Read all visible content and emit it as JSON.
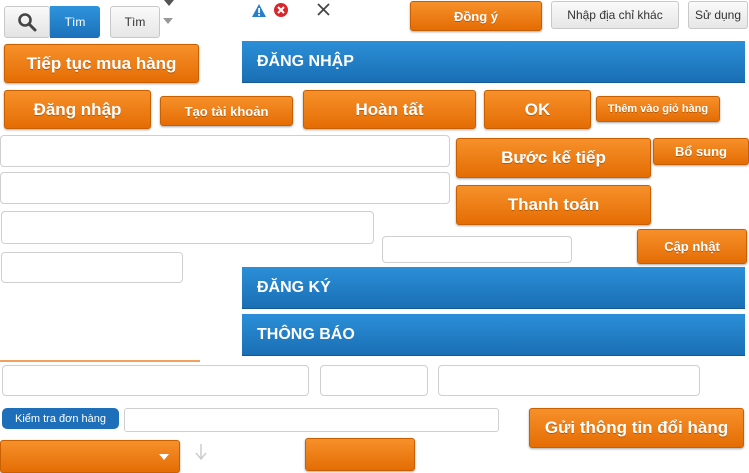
{
  "top_bar": {
    "search_button_label": "Tìm",
    "search_button2_label": "Tìm",
    "agree_label": "Đồng ý",
    "other_address_label": "Nhập địa chỉ khác",
    "use_label": "Sử dụng"
  },
  "buttons": {
    "continue_shopping": "Tiếp tục mua hàng",
    "login": "Đăng nhập",
    "create_account": "Tạo tài khoản",
    "complete": "Hoàn tất",
    "ok": "OK",
    "add_to_cart": "Thêm vào giỏ hàng",
    "next_step": "Bước kế tiếp",
    "supplement": "Bổ sung",
    "checkout": "Thanh toán",
    "update": "Cập nhật",
    "send_exchange_info": "Gửi thông tin đổi hàng",
    "check_order": "Kiểm tra đơn hàng"
  },
  "sections": {
    "login_header": "ĐĂNG NHẬP",
    "register_header": "ĐĂNG KÝ",
    "notice_header": "THÔNG BÁO"
  },
  "icons": {
    "search": "magnifier-icon",
    "warning": "warning-icon",
    "error": "error-icon",
    "close": "close-icon",
    "dropdown": "chevron-down-icon"
  },
  "colors": {
    "accent_orange": "#f08018",
    "header_blue": "#1f7cc4",
    "pill_blue": "#1c6fb8"
  }
}
